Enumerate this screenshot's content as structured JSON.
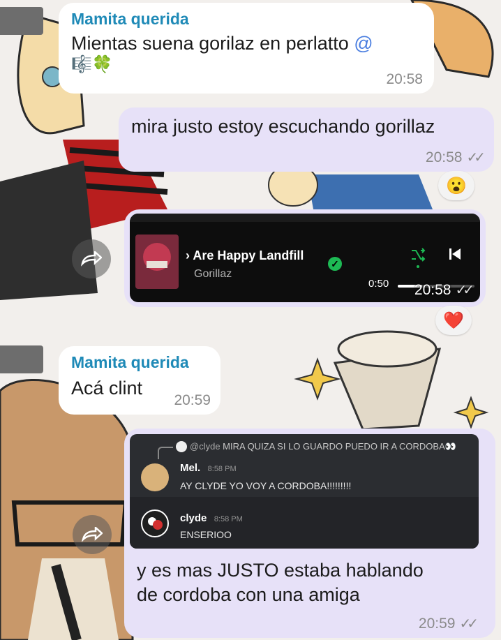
{
  "messages": {
    "m1": {
      "sender": "Mamita querida",
      "text": "Mientas suena gorilaz en perlatto",
      "mention": "@",
      "time": "20:58"
    },
    "m2": {
      "text": "mira justo estoy escuchando gorillaz",
      "time": "20:58"
    },
    "m2_reaction": "😮",
    "m3": {
      "time": "20:58",
      "player": {
        "track": "› Are Happy Landfill",
        "artist": "Gorillaz",
        "elapsed": "0:50",
        "progress": 0.32
      }
    },
    "m3_reaction": "❤️",
    "m4": {
      "sender": "Mamita querida",
      "text": "Acá clint",
      "time": "20:59"
    },
    "m5": {
      "reply": {
        "author": "@clyde",
        "text": "MIRA QUIZA SI LO GUARDO PUEDO IR A CORDOBA👀"
      },
      "discord": [
        {
          "name": "Mel.",
          "time": "8:58 PM",
          "text": "AY CLYDE YO VOY A CORDOBA!!!!!!!!!"
        },
        {
          "name": "clyde",
          "time": "8:58 PM",
          "text": "ENSERIOO"
        }
      ],
      "text_line1": "y es mas JUSTO estaba hablando",
      "text_line2": "de cordoba con una amiga",
      "time": "20:59"
    }
  },
  "icons": {
    "forward": "forward-arrow-icon",
    "read": "double-check-icon",
    "shuffle": "shuffle-icon",
    "previous": "skip-previous-icon",
    "verified": "check-circle-icon"
  },
  "colors": {
    "sender": "#1f8ab7",
    "outgoing": "#e7e1f8",
    "incoming": "#ffffff",
    "spotify_green": "#1db954"
  }
}
